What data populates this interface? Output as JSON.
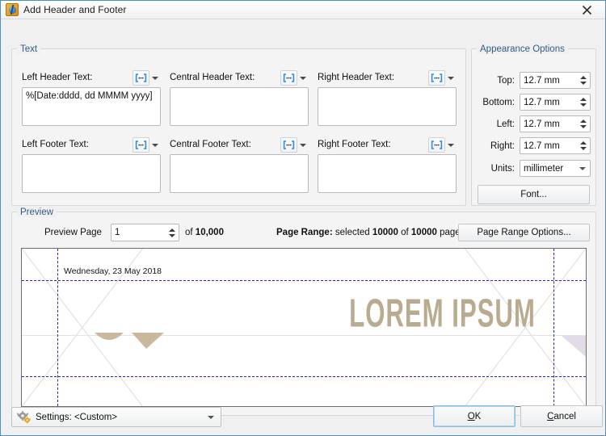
{
  "window": {
    "title": "Add Header and Footer",
    "icon": "pdf-app-icon",
    "close_label": "×"
  },
  "text_group": {
    "label": "Text",
    "fields": [
      {
        "name": "left-header",
        "label": "Left Header Text:",
        "value": "%[Date:dddd, dd MMMM yyyy]",
        "macro_icon": "macro-brackets-icon"
      },
      {
        "name": "central-header",
        "label": "Central Header Text:",
        "value": "",
        "macro_icon": "macro-brackets-icon"
      },
      {
        "name": "right-header",
        "label": "Right Header Text:",
        "value": "",
        "macro_icon": "macro-brackets-icon"
      },
      {
        "name": "left-footer",
        "label": "Left Footer Text:",
        "value": "",
        "macro_icon": "macro-brackets-icon"
      },
      {
        "name": "central-footer",
        "label": "Central Footer Text:",
        "value": "",
        "macro_icon": "macro-brackets-icon"
      },
      {
        "name": "right-footer",
        "label": "Right Footer Text:",
        "value": "",
        "macro_icon": "macro-brackets-icon"
      }
    ]
  },
  "appearance": {
    "label": "Appearance Options",
    "margins": [
      {
        "name": "top",
        "label": "Top:",
        "value": "12.7 mm"
      },
      {
        "name": "bottom",
        "label": "Bottom:",
        "value": "12.7 mm"
      },
      {
        "name": "left",
        "label": "Left:",
        "value": "12.7 mm"
      },
      {
        "name": "right",
        "label": "Right:",
        "value": "12.7 mm"
      }
    ],
    "units": {
      "label": "Units:",
      "value": "millimeter"
    },
    "font_button": "Font..."
  },
  "preview": {
    "label": "Preview",
    "page_label": "Preview Page",
    "page_value": "1",
    "of_prefix": "of",
    "total_pages": "10,000",
    "range_prefix": "Page Range:",
    "range_mid": "selected",
    "range_selected": "10000",
    "range_of": "of",
    "range_total": "10000",
    "range_suffix": "pages",
    "range_button": "Page Range Options...",
    "paper": {
      "header_date": "Wednesday, 23 May 2018",
      "watermark": "LOREM IPSUM"
    }
  },
  "footer": {
    "settings_label": "Settings:",
    "settings_value": "<Custom>",
    "settings_icon": "gear-icon",
    "ok": "OK",
    "ok_accel": "O",
    "ok_rest": "K",
    "cancel_accel": "C",
    "cancel_rest": "ancel",
    "cancel": "Cancel"
  },
  "colors": {
    "group_label": "#2f5b86",
    "margin_guide": "#2222dd",
    "watermark": "#b9ab90",
    "accent_focus": "#8abde0",
    "title_icon": "#e08a10"
  }
}
